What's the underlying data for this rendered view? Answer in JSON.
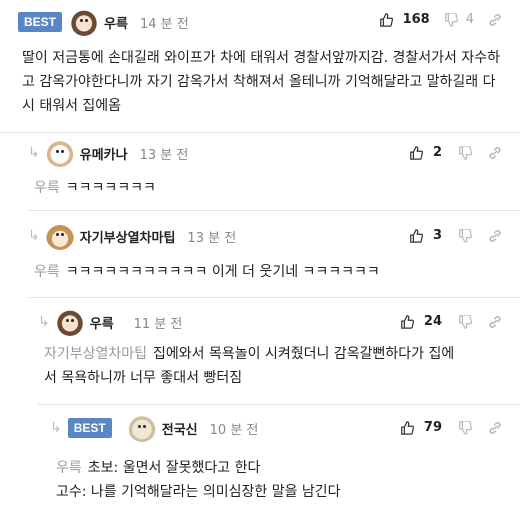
{
  "comments": [
    {
      "badge": "BEST",
      "nick": "우륵",
      "time": "14 분 전",
      "likes": "168",
      "dislikes": "4",
      "text": "딸이 저금통에 손대길래 와이프가 차에 태워서 경찰서앞까지감. 경찰서가서 자수하고 감옥가야한다니까 자기 감옥가서 착해져서 올테니까 기억해달라고 말하길래 다시 태워서 집에옴"
    },
    {
      "nick": "유메카나",
      "time": "13 분 전",
      "likes": "2",
      "mention": "우륵",
      "text": "ㅋㅋㅋㅋㅋㅋㅋ"
    },
    {
      "nick": "자기부상열차마팁",
      "time": "13 분 전",
      "likes": "3",
      "mention": "우륵",
      "text": "ㅋㅋㅋㅋㅋㅋㅋㅋㅋㅋㅋ 이게 더 웃기네 ㅋㅋㅋㅋㅋㅋ"
    },
    {
      "nick": "우륵",
      "time": "11 분 전",
      "likes": "24",
      "mention": "자기부상열차마팁",
      "text_line1": "집에와서 목욕놀이 시켜줬더니 감옥갈뻔하다가 집에",
      "text_line2": "서 목욕하니까 너무 좋대서 빵터짐"
    },
    {
      "badge": "BEST",
      "nick": "전국신",
      "time": "10 분 전",
      "likes": "79",
      "mention": "우륵",
      "text_line1": "초보: 울면서 잘못했다고 한다",
      "text_line2": "고수: 나를 기억해달라는 의미심장한 말을 남긴다"
    }
  ]
}
